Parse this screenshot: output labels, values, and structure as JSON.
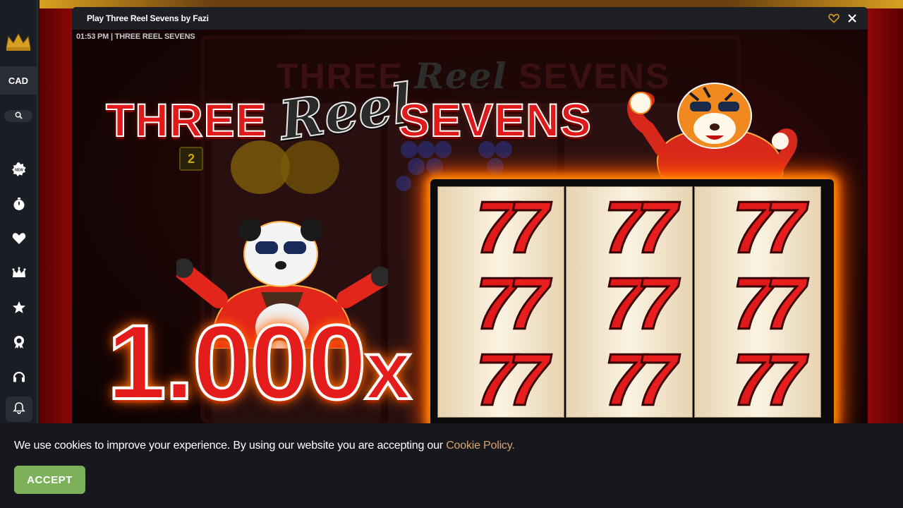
{
  "window": {
    "title": "Play Three Reel Sevens by Fazi",
    "clock": "01:53 PM",
    "game_name": "THREE REEL SEVENS"
  },
  "sidebar": {
    "currency": "CAD",
    "icons": [
      "crown-logo",
      "search-icon",
      "new-badge-icon",
      "stopwatch-icon",
      "heart-icon",
      "crown-icon",
      "star-icon",
      "trophy-icon",
      "headset-icon",
      "bell-icon"
    ]
  },
  "game": {
    "title_left": "THREE",
    "title_middle": "Reel",
    "title_right": "SEVENS",
    "multiplier_number": "1.000",
    "multiplier_suffix": "x",
    "badge_number": "2",
    "grid_symbol": "7"
  },
  "cookie": {
    "text": "We use cookies to improve your experience. By using our website you are accepting our",
    "link": "Cookie Policy.",
    "accept_label": "ACCEPT"
  },
  "colors": {
    "accent_gold": "#d8a020",
    "accept_green": "#7cb15a",
    "link_tan": "#d9a46a",
    "seven_red": "#e01a1a"
  }
}
